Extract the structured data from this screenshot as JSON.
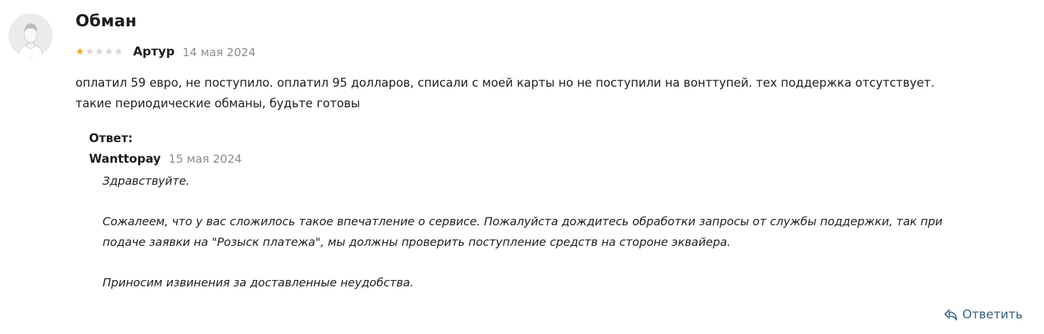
{
  "review": {
    "title": "Обман",
    "rating": 1,
    "rating_max": 5,
    "author": "Артур",
    "date": "14 мая 2024",
    "text_lines": [
      "оплатил 59 евро, не поступило. оплатил 95 долларов, списали с моей карты но не поступили на вонттупей. тех поддержка отсутствует.",
      "такие периодические обманы, будьте готовы"
    ],
    "colors": {
      "star_filled": "#f2a31b",
      "star_empty": "#d3d3d3",
      "date": "#8c8c8c",
      "link": "#2f5e86"
    },
    "avatar_icon": "user-silhouette-icon"
  },
  "answer": {
    "label": "Ответ:",
    "author": "Wanttopay",
    "date": "15 мая 2024",
    "paragraphs": {
      "greeting": "Здравствуйте.",
      "line1": "Сожалеем, что у вас сложилось такое впечатление о сервисе. Пожалуйста дождитесь обработки запросы от службы поддержки, так при",
      "line2": "подаче заявки на \"Розыск платежа\", мы должны проверить поступление средств на стороне эквайера.",
      "closing": "Приносим извинения за доставленные неудобства."
    }
  },
  "actions": {
    "reply_label": "Ответить",
    "reply_icon": "reply-arrow-icon"
  }
}
